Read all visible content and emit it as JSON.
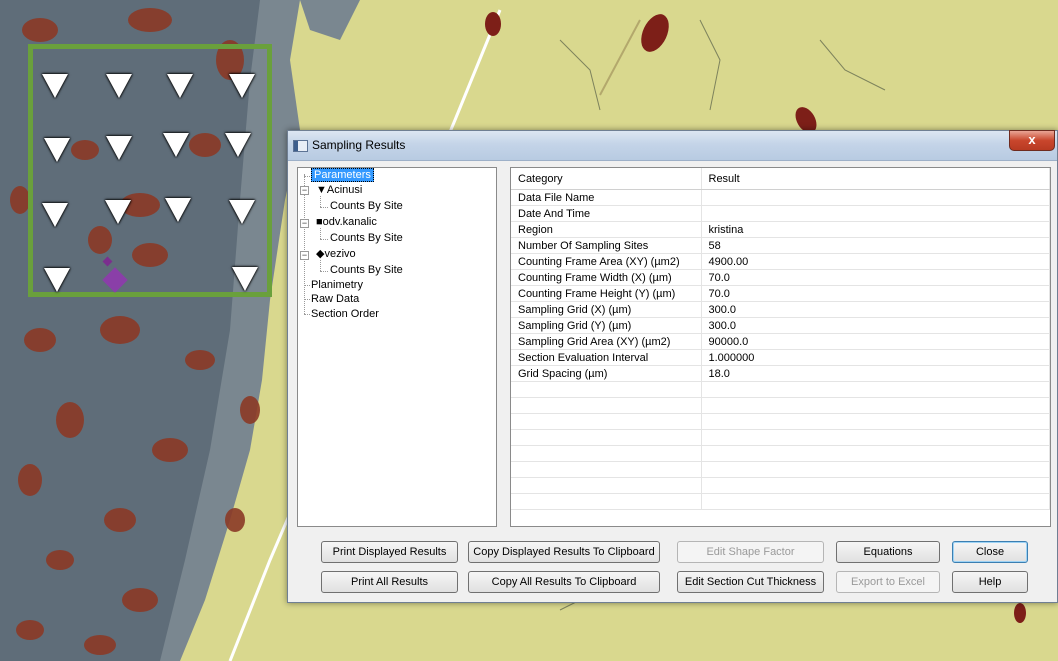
{
  "window": {
    "title": "Sampling Results",
    "close_glyph": "x"
  },
  "tree": {
    "items": [
      {
        "label": "Parameters",
        "selected": true
      },
      {
        "label": "▼Acinusi",
        "expandable": true
      },
      {
        "label": "Counts By Site"
      },
      {
        "label": "■odv.kanalic",
        "expandable": true
      },
      {
        "label": "Counts By Site"
      },
      {
        "label": "◆vezivo",
        "expandable": true
      },
      {
        "label": "Counts By Site"
      },
      {
        "label": "Planimetry"
      },
      {
        "label": "Raw Data"
      },
      {
        "label": "Section Order"
      }
    ]
  },
  "table": {
    "headers": [
      "Category",
      "Result"
    ],
    "rows": [
      [
        "Data File Name",
        ""
      ],
      [
        "Date And Time",
        ""
      ],
      [
        "Region",
        "kristina"
      ],
      [
        "Number Of Sampling Sites",
        "58"
      ],
      [
        "Counting Frame Area (XY) (µm2)",
        "4900.00"
      ],
      [
        "Counting Frame Width (X) (µm)",
        "70.0"
      ],
      [
        "Counting Frame Height (Y) (µm)",
        "70.0"
      ],
      [
        "Sampling Grid (X) (µm)",
        "300.0"
      ],
      [
        "Sampling Grid (Y) (µm)",
        "300.0"
      ],
      [
        "Sampling Grid Area (XY) (µm2)",
        "90000.0"
      ],
      [
        "Section Evaluation Interval",
        "1.000000"
      ],
      [
        "Grid Spacing (µm)",
        "18.0"
      ]
    ],
    "empty_rows": 8
  },
  "buttons": {
    "print_displayed": "Print Displayed Results",
    "copy_displayed": "Copy Displayed Results To Clipboard",
    "edit_shape_factor": "Edit Shape Factor",
    "equations": "Equations",
    "close": "Close",
    "print_all": "Print All Results",
    "copy_all": "Copy All Results To Clipboard",
    "edit_section_cut": "Edit Section Cut Thickness",
    "export_excel": "Export to Excel",
    "help": "Help"
  },
  "colors": {
    "counting_frame": "#6aa03c",
    "marker_acinusi": "#ffffff",
    "marker_vezivo": "#8a3fa8",
    "selection": "#3399ff"
  }
}
